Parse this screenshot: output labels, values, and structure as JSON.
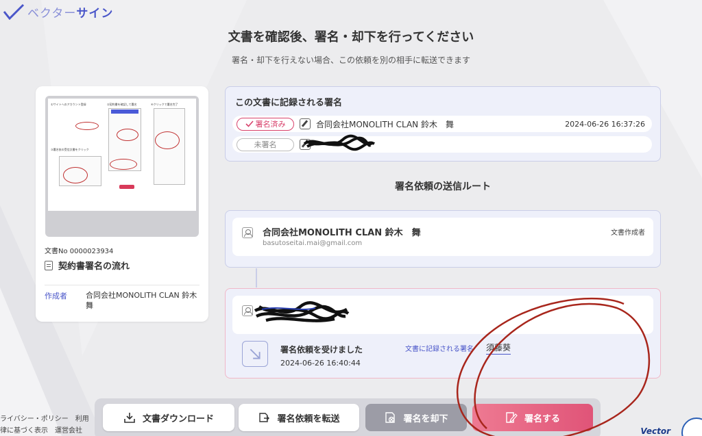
{
  "brand": {
    "name_part1": "ベクター",
    "name_part2": "サイン",
    "accent": "#4a56c9"
  },
  "page": {
    "title": "文書を確認後、署名・却下を行ってください",
    "subtitle": "署名・却下を行えない場合、この依頼を別の相手に転送できます"
  },
  "document": {
    "number": "文書No 0000023934",
    "name": "契約書署名の流れ",
    "creator_label": "作成者",
    "creator_value": "合同会社MONOLITH CLAN 鈴木 舞",
    "thumbnail_steps": {
      "s1": "①サイトへのアカウント登録",
      "s2": "②契約書を確認して署名",
      "s3": "④クリックで署名完了",
      "s4": "③署名依の受信文書をクリック"
    }
  },
  "signatures": {
    "title": "この文書に記録される署名",
    "rows": [
      {
        "status": "署名済み",
        "name": "合同会社MONOLITH CLAN 鈴木　舞",
        "time": "2024-06-26 16:37:26",
        "color": "#d8406b"
      },
      {
        "status": "未署名",
        "name": "",
        "time": ""
      }
    ]
  },
  "route": {
    "title": "署名依頼の送信ルート",
    "sender": {
      "name": "合同会社MONOLITH CLAN 鈴木　舞",
      "email": "basutoseitai.mai@gmail.com",
      "role": "文書作成者"
    },
    "recipient": {
      "received_title": "署名依頼を受けました",
      "received_time": "2024-06-26 16:40:44",
      "recorded_label": "文書に記録される署名",
      "recorded_name": "須藤葵"
    }
  },
  "actions": {
    "download": "文書ダウンロード",
    "forward": "署名依頼を転送",
    "reject": "署名を却下",
    "sign": "署名する"
  },
  "footer": {
    "line1": "ライバシー・ポリシー　利用",
    "line2": "律に基づく表示　運営会社",
    "corner_logo": "Vector"
  }
}
